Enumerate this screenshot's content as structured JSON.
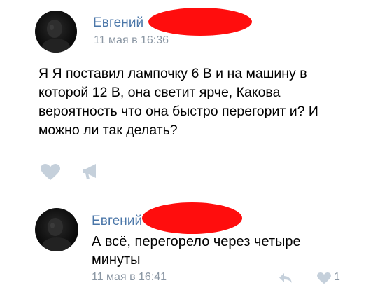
{
  "post": {
    "author_name": "Евгений",
    "time": "11 мая в 16:36",
    "text_lines": [
      "Я Я поставил лампочку 6 В и на машину в",
      "которой 12 В, она светит ярче, Какова",
      "вероятность что она быстро перегорит и? И",
      "можно ли так делать?"
    ],
    "actions": {
      "like_icon": "heart-icon",
      "share_icon": "megaphone-icon"
    }
  },
  "comment": {
    "author_name": "Евгений",
    "text_lines": [
      "А всё, перегорело через четыре",
      "минуты"
    ],
    "time": "11 мая в 16:41",
    "reply_icon": "reply-arrow-icon",
    "like_icon": "heart-icon",
    "like_count": "1"
  },
  "colors": {
    "author_link": "#4a76a8",
    "meta_gray": "#8a96a3",
    "icon_gray": "#c5d0db",
    "redaction": "#ff0d0d"
  }
}
